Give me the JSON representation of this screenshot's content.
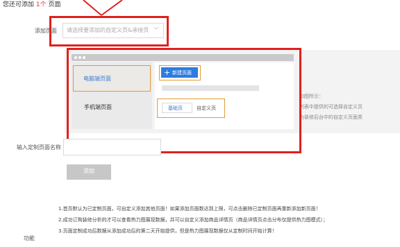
{
  "header": {
    "prefix": "您还可添加",
    "count": "1个",
    "suffix": "页面"
  },
  "add_page": {
    "label": "添加页面",
    "placeholder": "请选择要添加的自定义页&承接页"
  },
  "preview": {
    "sidebar_items": [
      "电脑端页面",
      "手机端页面"
    ],
    "new_page_label": "新建页面",
    "tabs": [
      "基础页",
      "自定义页"
    ],
    "notes": [
      "如图所示：",
      "列表中提供的可选择自定义页",
      "为装修后台中的自定义页面类"
    ]
  },
  "custom_page_name": {
    "label": "输入定制页面名称",
    "value": ""
  },
  "add_button_label": "添加",
  "function_label": "功能",
  "notices": [
    "1.首页默认为已定制页面，可自定义添加其他页面！如果添加页面数达到上限，可点击删除已定制页面再重新添加新页面！",
    "2.成功订购装修分析的才可以查看热力图展现数据，并可以自定义添加商品详情页（商品详情页点击分布仅提供热力图模式）；",
    "3.页面定制成功后数据从添加成功后的第二天开始提供，但是热力图展现数据仅从定制时间开始计算！"
  ],
  "colors": {
    "annotation_red": "#e0201d",
    "highlight_orange": "#e39a35",
    "primary_blue": "#2f7be0"
  }
}
